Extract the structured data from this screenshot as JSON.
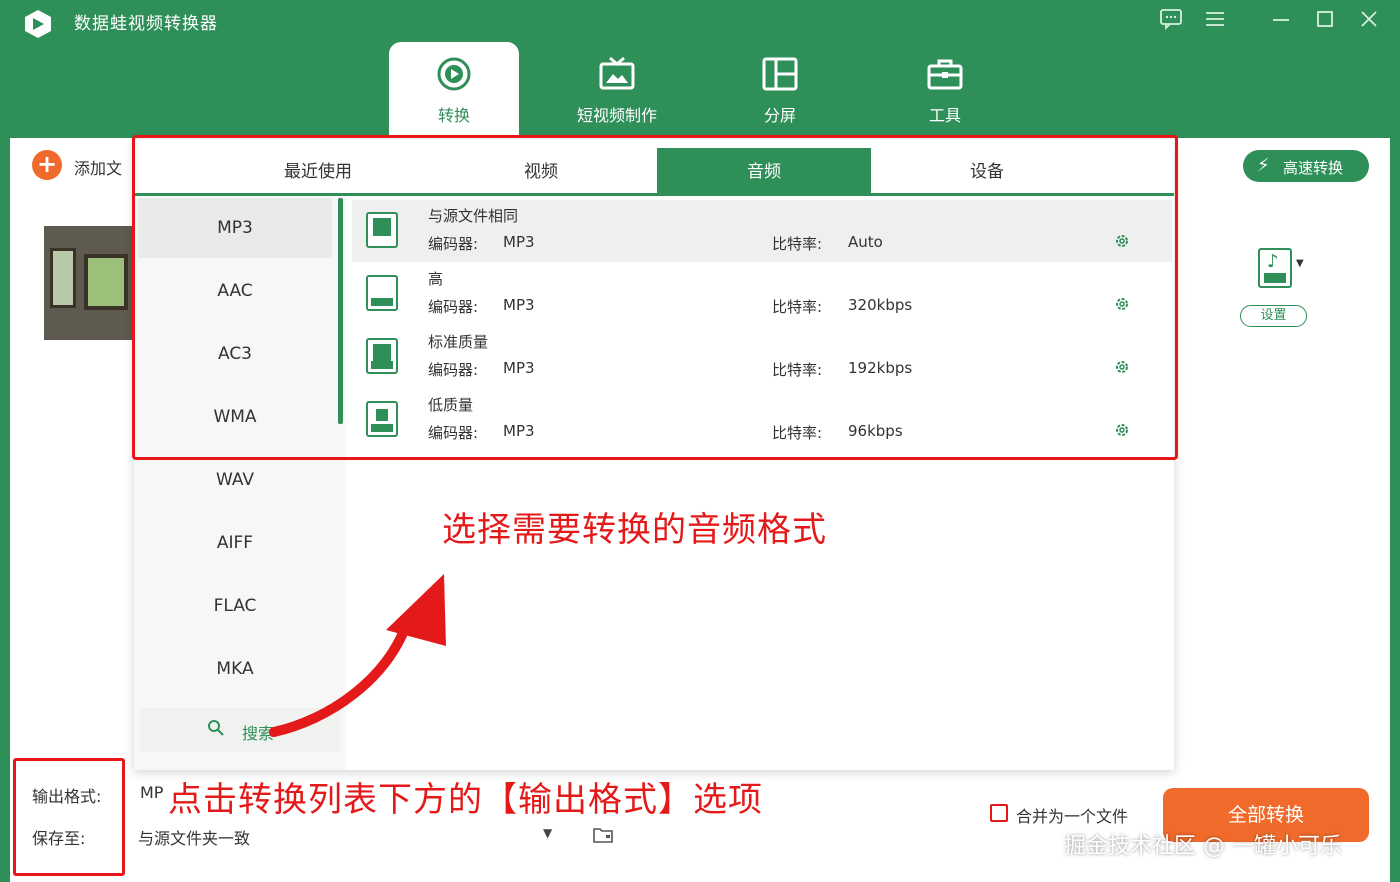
{
  "app": {
    "title": "数据蛙视频转换器"
  },
  "colors": {
    "brand": "#2f8f58",
    "accent": "#f06a2b",
    "annotation": "#e41a1a"
  },
  "main_tabs": [
    {
      "label": "转换",
      "icon": "convert-icon",
      "active": true
    },
    {
      "label": "短视频制作",
      "icon": "tv-icon"
    },
    {
      "label": "分屏",
      "icon": "split-screen-icon"
    },
    {
      "label": "工具",
      "icon": "toolbox-icon"
    }
  ],
  "toolbar": {
    "add_file": "添加文",
    "speed_convert": "高速转换"
  },
  "format_side": {
    "settings": "设置"
  },
  "panel": {
    "category_tabs": [
      "最近使用",
      "视频",
      "音频",
      "设备"
    ],
    "active_category": "音频",
    "formats": [
      "MP3",
      "AAC",
      "AC3",
      "WMA",
      "WAV",
      "AIFF",
      "FLAC",
      "MKA"
    ],
    "selected_format": "MP3",
    "search_label": "搜索",
    "encoder_label": "编码器:",
    "bitrate_label": "比特率:",
    "qualities": [
      {
        "name": "与源文件相同",
        "encoder": "MP3",
        "bitrate": "Auto"
      },
      {
        "name": "高",
        "encoder": "MP3",
        "bitrate": "320kbps"
      },
      {
        "name": "标准质量",
        "encoder": "MP3",
        "bitrate": "192kbps"
      },
      {
        "name": "低质量",
        "encoder": "MP3",
        "bitrate": "96kbps"
      }
    ]
  },
  "annotations": {
    "select_format": "选择需要转换的音频格式",
    "click_output": "点击转换列表下方的【输出格式】选项"
  },
  "bottom": {
    "output_format_label": "输出格式:",
    "output_format_value": "MP",
    "save_to_label": "保存至:",
    "save_to_value": "与源文件夹一致",
    "merge_label": "合并为一个文件",
    "convert_all": "全部转换"
  },
  "watermark": "掘金技术社区 @ 一罐小可乐"
}
